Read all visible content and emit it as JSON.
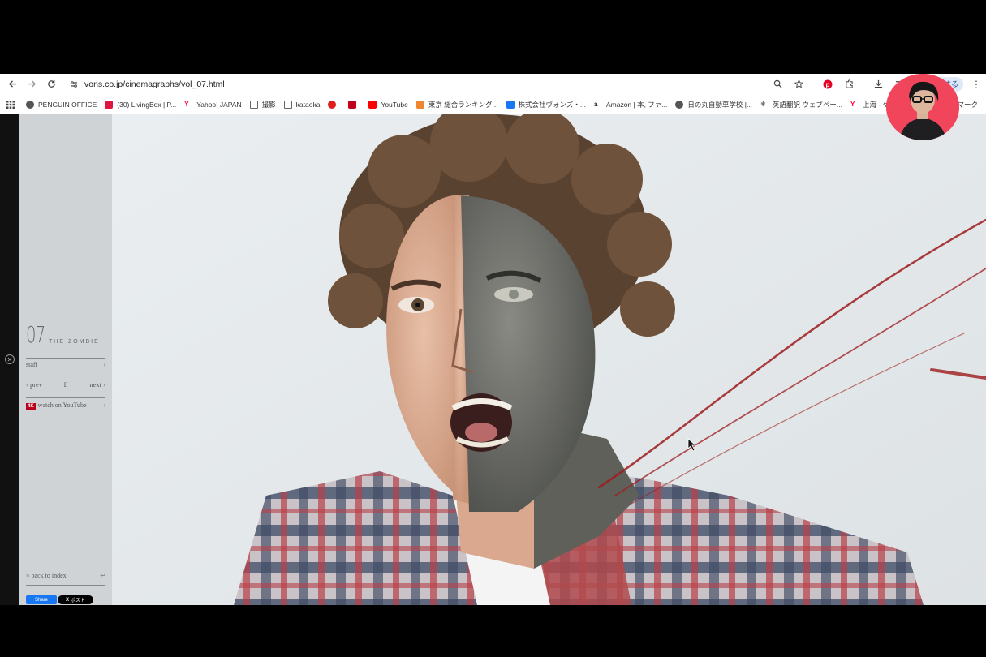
{
  "browser": {
    "url": "vons.co.jp/cinemagraphs/vol_07.html",
    "profile_label": "する",
    "bookmarks": [
      {
        "label": "PENGUIN OFFICE",
        "color": "#555555"
      },
      {
        "label": "(30) LivingBox | P...",
        "color": "#e0143c"
      },
      {
        "label": "Yahoo! JAPAN",
        "color": "#ff0033"
      },
      {
        "label": "撮影",
        "color": "#666666"
      },
      {
        "label": "kataoka",
        "color": "#666666"
      },
      {
        "label": "",
        "color": "#e01c1c"
      },
      {
        "label": "",
        "color": "#c0001a"
      },
      {
        "label": "YouTube",
        "color": "#ff0000"
      },
      {
        "label": "東京 総合ランキング...",
        "color": "#f0862f"
      },
      {
        "label": "株式会社ヴォンズ・...",
        "color": "#1877f2"
      },
      {
        "label": "Amazon | 本, ファ...",
        "color": "#222222"
      },
      {
        "label": "日の丸自動車学校 |...",
        "color": "#555555"
      },
      {
        "label": "英語翻訳 ウェブペー...",
        "color": "#777777"
      },
      {
        "label": "上海 - ゲームならYa...",
        "color": "#ff0033"
      }
    ],
    "bookmarks_more": "マーク"
  },
  "sidebar": {
    "vol_number": "07",
    "vol_title": "THE ZOMBIE",
    "staff_label": "staff",
    "prev_label": "prev",
    "next_label": "next",
    "pause_label": "II",
    "badge_4k": "4K",
    "youtube_label": "watch on YouTube",
    "back_label": "back to index",
    "fb_share_label": "Share",
    "x_post_label": "ポスト"
  },
  "icons": {
    "back": "arrow-left-icon",
    "forward": "arrow-right-icon",
    "reload": "reload-icon",
    "site_info": "tune-icon",
    "zoom": "magnifier-icon",
    "star": "star-icon",
    "pinterest": "pinterest-icon",
    "extensions": "puzzle-icon",
    "download": "download-icon",
    "media": "media-queue-icon",
    "apps": "apps-grid-icon"
  }
}
